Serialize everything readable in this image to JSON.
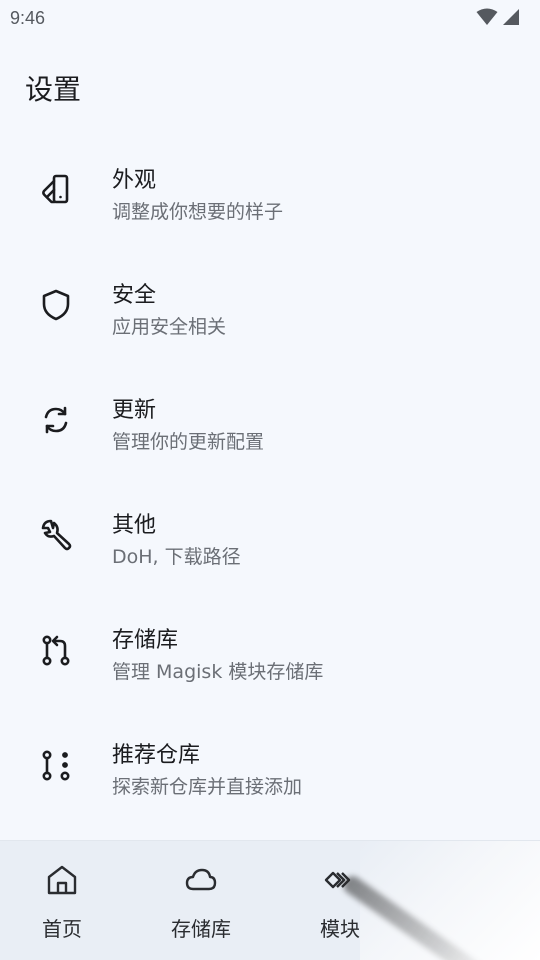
{
  "status_bar": {
    "time": "9:46"
  },
  "page": {
    "title": "设置"
  },
  "items": [
    {
      "title": "外观",
      "subtitle": "调整成你想要的样子",
      "icon": "appearance-icon"
    },
    {
      "title": "安全",
      "subtitle": "应用安全相关",
      "icon": "shield-icon"
    },
    {
      "title": "更新",
      "subtitle": "管理你的更新配置",
      "icon": "refresh-icon"
    },
    {
      "title": "其他",
      "subtitle": "DoH, 下载路径",
      "icon": "wrench-icon"
    },
    {
      "title": "存储库",
      "subtitle": "管理 Magisk 模块存储库",
      "icon": "repo-icon"
    },
    {
      "title": "推荐仓库",
      "subtitle": "探索新仓库并直接添加",
      "icon": "recommended-repo-icon"
    }
  ],
  "bottom_nav": [
    {
      "label": "首页",
      "icon": "home-icon"
    },
    {
      "label": "存储库",
      "icon": "cloud-icon"
    },
    {
      "label": "模块",
      "icon": "modules-icon"
    }
  ],
  "colors": {
    "background": "#f5f8fd",
    "nav_background": "#e9eef5",
    "text_primary": "#1b1c1f",
    "text_secondary": "#6b6f76"
  }
}
